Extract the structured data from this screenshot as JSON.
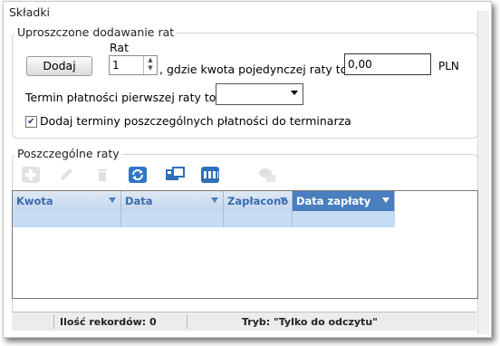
{
  "section_title": "Składki",
  "simplified": {
    "legend": "Uproszczone dodawanie rat",
    "add_button": "Dodaj",
    "rat_label": "Rat",
    "rat_value": "1",
    "amount_text": ", gdzie kwota pojedynczej raty to",
    "amount_value": "0,00",
    "currency": "PLN",
    "first_due_label": "Termin płatności pierwszej raty to",
    "first_due_value": "",
    "checkbox_checked": true,
    "checkbox_label": "Dodaj terminy poszczególnych płatności do terminarza"
  },
  "installments": {
    "legend": "Poszczególne raty",
    "toolbar": [
      {
        "name": "add-icon",
        "enabled": false
      },
      {
        "name": "edit-icon",
        "enabled": false
      },
      {
        "name": "delete-icon",
        "enabled": false
      },
      {
        "name": "refresh-icon",
        "enabled": true
      },
      {
        "name": "export-icon",
        "enabled": true
      },
      {
        "name": "columns-icon",
        "enabled": true
      },
      {
        "name": "payment-icon",
        "enabled": false
      }
    ],
    "columns": [
      "Kwota",
      "Data",
      "Zapłacono",
      "Data zapłaty"
    ],
    "active_column": 3,
    "rows": []
  },
  "status": {
    "record_count": "Ilość rekordów: 0",
    "mode": "Tryb: \"Tylko do odczytu\""
  },
  "colors": {
    "header_blue": "#c3d6ee",
    "active_header": "#4a7fbf",
    "filter_row": "#c5dcf4"
  }
}
